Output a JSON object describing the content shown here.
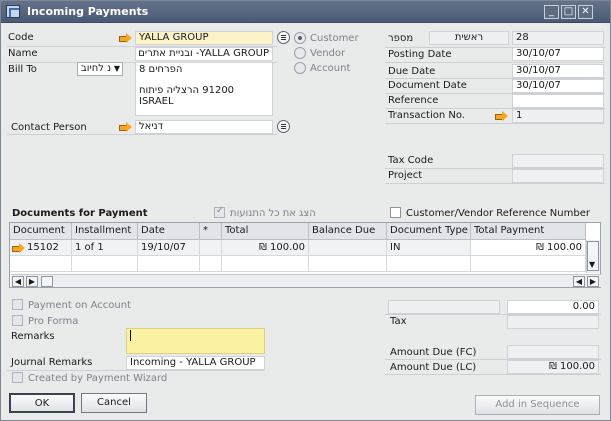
{
  "window": {
    "title": "Incoming Payments",
    "minimize": "_",
    "maximize": "□",
    "close": "✕"
  },
  "left": {
    "code_label": "Code",
    "code_value": "YALLA GROUP",
    "name_label": "Name",
    "name_value": "YALLA GROUP- ובניית אתרים",
    "bill_to_label": "Bill To",
    "bill_to_select": "נ לחיוב",
    "address_line1": "הפרחים 8",
    "address_line2": "91200 הרצליה פיתוח",
    "address_line3": "ISRAEL",
    "contact_label": "Contact Person",
    "contact_value": "דניאל"
  },
  "radios": {
    "customer": "Customer",
    "vendor": "Vendor",
    "account": "Account"
  },
  "right": {
    "series_label": "מספר",
    "series_value": "ראשית",
    "number_value": "28",
    "posting_label": "Posting Date",
    "posting_value": "30/10/07",
    "due_label": "Due Date",
    "due_value": "30/10/07",
    "doc_date_label": "Document Date",
    "doc_date_value": "30/10/07",
    "reference_label": "Reference",
    "reference_value": "",
    "trans_label": "Transaction No.",
    "trans_value": "1",
    "tax_code_label": "Tax Code",
    "project_label": "Project"
  },
  "docs": {
    "section_label": "Documents for Payment",
    "show_all_label": "הצג את כל התנועות",
    "ref_number_label": "Customer/Vendor Reference Number",
    "columns": [
      "Document",
      "Installment",
      "Date",
      "*",
      "Total",
      "Balance Due",
      "Document Type",
      "Total Payment"
    ],
    "row": {
      "document": "15102",
      "installment": "1 of 1",
      "date": "19/10/07",
      "total": "₪ 100.00",
      "balance_due": "",
      "doc_type": "IN",
      "total_payment": "₪ 100.00"
    }
  },
  "bottom": {
    "payment_on_account": "Payment on Account",
    "pro_forma": "Pro Forma",
    "remarks_label": "Remarks",
    "remarks_value": "",
    "journal_label": "Journal Remarks",
    "journal_value": "Incoming - YALLA GROUP",
    "wizard_label": "Created by Payment Wizard",
    "amount_value": "0.00",
    "tax_label": "Tax",
    "amount_fc_label": "Amount Due (FC)",
    "amount_lc_label": "Amount Due (LC)",
    "amount_lc_value": "₪ 100.00"
  },
  "buttons": {
    "ok": "OK",
    "cancel": "Cancel",
    "add_in_sequence": "Add in Sequence"
  }
}
